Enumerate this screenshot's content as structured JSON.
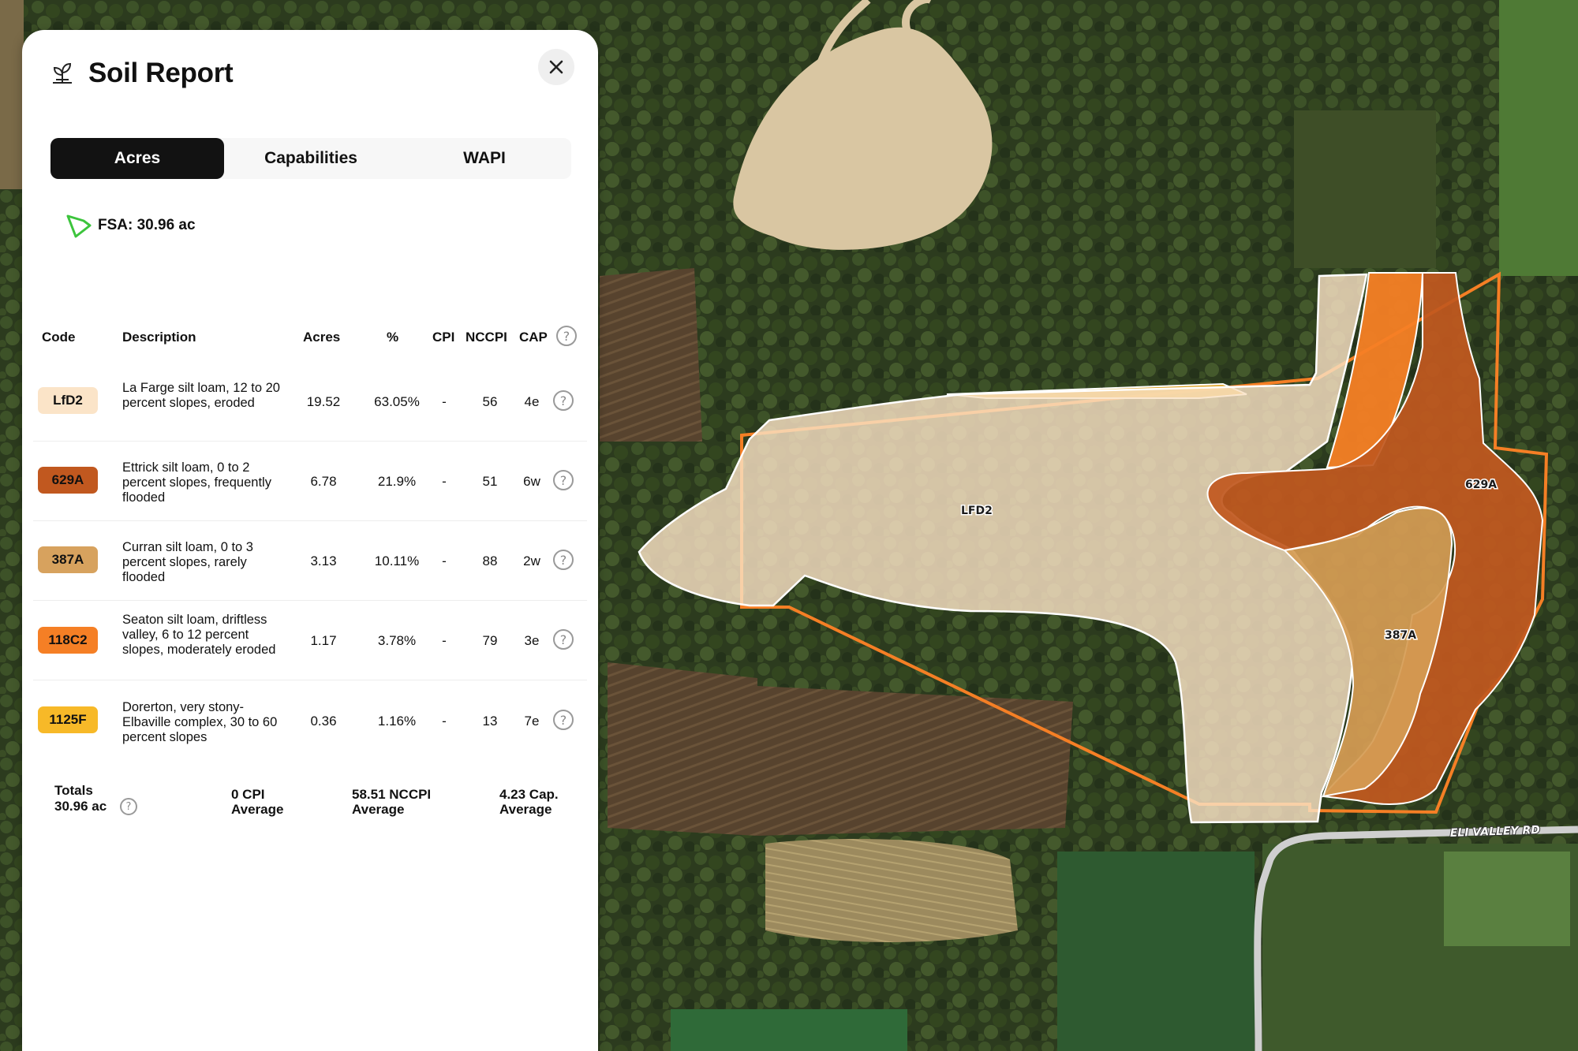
{
  "panel": {
    "title": "Soil Report",
    "header_icon": "plant-sprout-icon",
    "close_icon": "close-icon",
    "tabs": [
      {
        "label": "Acres",
        "active": true
      },
      {
        "label": "Capabilities",
        "active": false
      },
      {
        "label": "WAPI",
        "active": false
      }
    ],
    "fsa_label": "FSA: 30.96 ac",
    "fsa_icon": "field-boundary-icon",
    "fsa_color": "#3cc43c"
  },
  "table": {
    "columns": [
      "Code",
      "Description",
      "Acres",
      "%",
      "CPI",
      "NCCPI",
      "CAP"
    ],
    "rows": [
      {
        "code": "LfD2",
        "color": "#fbe4c8",
        "description": "La Farge silt loam, 12 to 20 percent slopes, eroded",
        "acres": "19.52",
        "percent": "63.05%",
        "cpi": "-",
        "nccpi": "56",
        "cap": "4e"
      },
      {
        "code": "629A",
        "color": "#c1581f",
        "description": "Ettrick silt loam, 0 to 2 percent slopes, frequently flooded",
        "acres": "6.78",
        "percent": "21.9%",
        "cpi": "-",
        "nccpi": "51",
        "cap": "6w"
      },
      {
        "code": "387A",
        "color": "#d7a25e",
        "description": "Curran silt loam, 0 to 3 percent slopes, rarely flooded",
        "acres": "3.13",
        "percent": "10.11%",
        "cpi": "-",
        "nccpi": "88",
        "cap": "2w"
      },
      {
        "code": "118C2",
        "color": "#f57f25",
        "description": "Seaton silt loam, driftless valley, 6 to 12 percent slopes, moderately eroded",
        "acres": "1.17",
        "percent": "3.78%",
        "cpi": "-",
        "nccpi": "79",
        "cap": "3e"
      },
      {
        "code": "1125F",
        "color": "#f7b928",
        "description": "Dorerton, very stony-Elbaville complex, 30 to 60 percent slopes",
        "acres": "0.36",
        "percent": "1.16%",
        "cpi": "-",
        "nccpi": "13",
        "cap": "7e"
      }
    ]
  },
  "totals": {
    "label": "Totals",
    "acres": "30.96 ac",
    "cpi_value": "0 CPI",
    "cpi_caption": "Average",
    "nccpi_value": "58.51 NCCPI",
    "nccpi_caption": "Average",
    "cap_value": "4.23 Cap.",
    "cap_caption": "Average"
  },
  "map": {
    "labels": {
      "lfd2": "LFD2",
      "a629": "629A",
      "a387": "387A"
    },
    "road_label": "ELI VALLEY RD"
  }
}
